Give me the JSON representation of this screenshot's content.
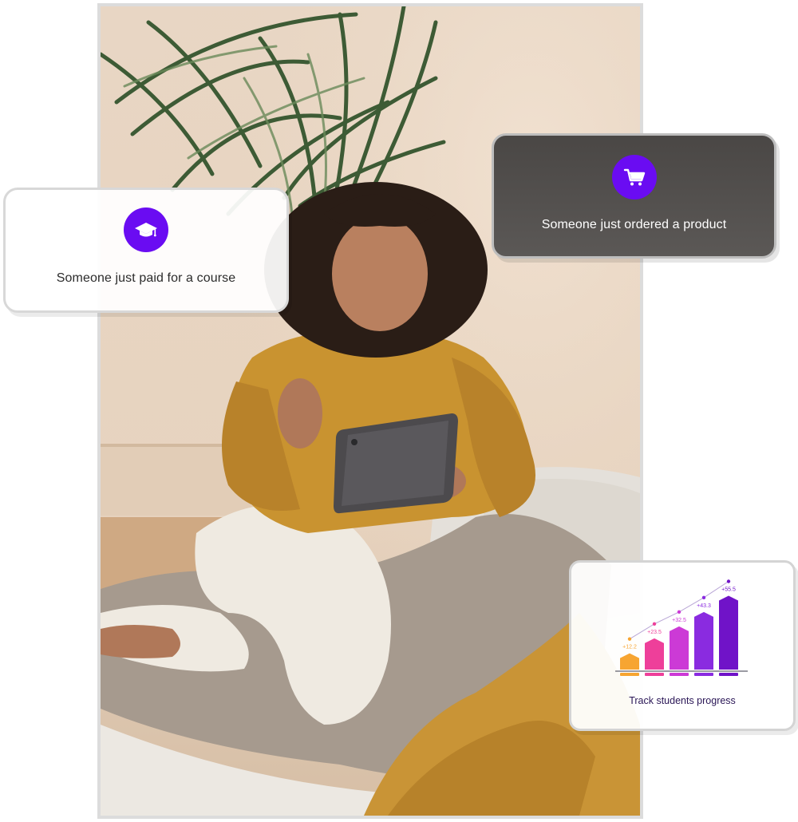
{
  "cards": {
    "course": {
      "icon": "graduation-cap-icon",
      "text": "Someone just paid for a course"
    },
    "order": {
      "icon": "shopping-cart-icon",
      "text": "Someone just ordered a product"
    },
    "progress": {
      "title": "Track students progress"
    }
  },
  "colors": {
    "accent": "#6a0cf2",
    "dark_card": "#4d4a48"
  },
  "chart_data": {
    "type": "bar",
    "values": [
      12.2,
      23.5,
      32.5,
      43.3,
      55.5
    ],
    "labels": [
      "+12.2",
      "+23.5",
      "+32.5",
      "+43.3",
      "+55.5"
    ],
    "colors": [
      "#f7a531",
      "#ee3f9a",
      "#cc3ad6",
      "#8a2be0",
      "#7013c8"
    ],
    "ylim": [
      0,
      60
    ]
  }
}
